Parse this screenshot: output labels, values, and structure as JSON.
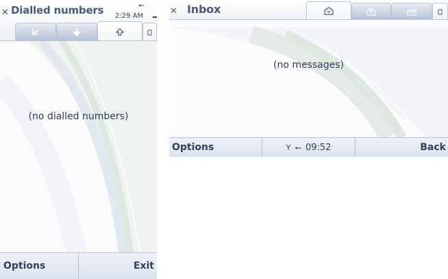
{
  "left_screen": {
    "title": "Dialled numbers",
    "clock": "2:29 AM",
    "tabs": [
      {
        "icon": "received-call-icon",
        "active": false
      },
      {
        "icon": "missed-call-icon",
        "active": false
      },
      {
        "icon": "dialled-call-icon",
        "active": true
      }
    ],
    "empty_message": "(no dialled numbers)",
    "softkeys": {
      "left": "Options",
      "right": "Exit"
    }
  },
  "right_screen": {
    "title": "Inbox",
    "tabs": [
      {
        "icon": "inbox-icon",
        "active": true
      },
      {
        "icon": "sent-icon",
        "active": false
      },
      {
        "icon": "drafts-icon",
        "active": false
      }
    ],
    "empty_message": "(no messages)",
    "softkeys": {
      "left": "Options",
      "right": "Back"
    },
    "status_time": "09:52"
  },
  "colors": {
    "title_text": "#4a5a78",
    "tab_bar": "#b4c1d6",
    "softkey_bg": "#e4e9f1"
  }
}
